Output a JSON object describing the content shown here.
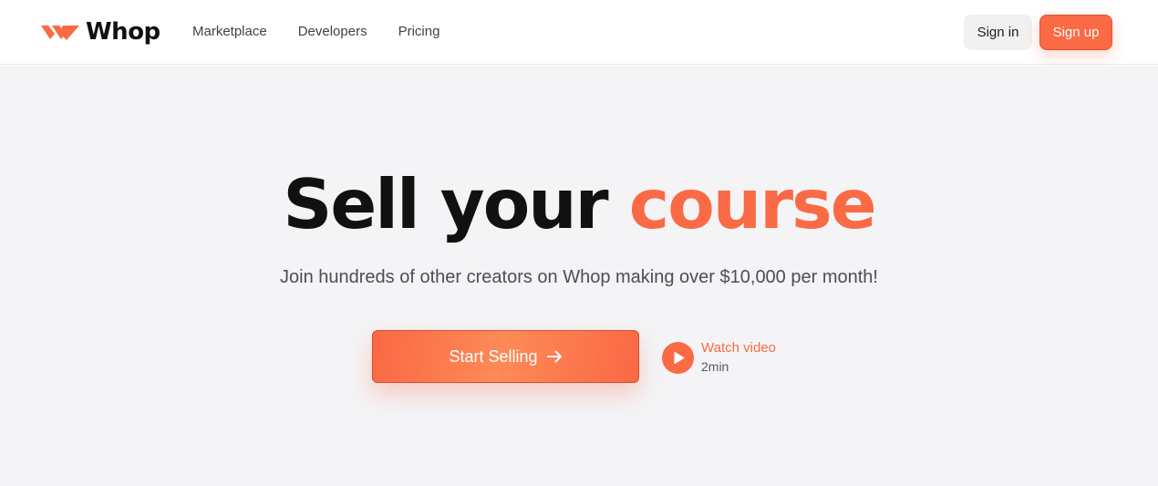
{
  "header": {
    "brand_name": "Whop",
    "nav": [
      {
        "label": "Marketplace"
      },
      {
        "label": "Developers"
      },
      {
        "label": "Pricing"
      }
    ],
    "sign_in_label": "Sign in",
    "sign_up_label": "Sign up"
  },
  "hero": {
    "headline_start": "Sell your",
    "headline_accent": "course",
    "subheadline": "Join hundreds of other creators on Whop making over $10,000 per month!",
    "cta_label": "Start Selling",
    "video_label": "Watch video",
    "video_duration": "2min"
  },
  "icons": {
    "logo": "whop-logo-mark",
    "cta": "arrow-right-icon",
    "video": "play-icon"
  },
  "colors": {
    "accent": "#fa6a44",
    "text_dark": "#111111",
    "hero_background": "#f4f4f6"
  }
}
